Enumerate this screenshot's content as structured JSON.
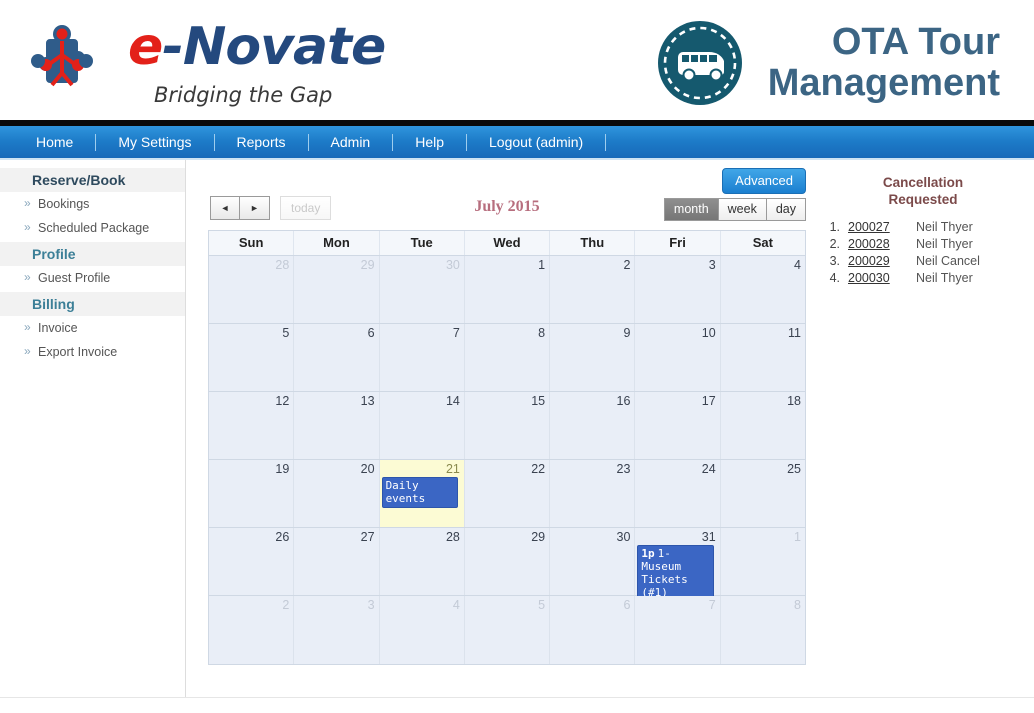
{
  "header": {
    "brand": {
      "prefix": "e",
      "dash": "-",
      "mid": "Novate",
      "tagline": "Bridging the Gap"
    },
    "app_title_line1": "OTA Tour",
    "app_title_line2": "Management",
    "bus_icon": "bus-icon",
    "logo_icon": "puzzle-person-logo"
  },
  "nav": {
    "items": [
      {
        "label": "Home"
      },
      {
        "label": "My Settings"
      },
      {
        "label": "Reports"
      },
      {
        "label": "Admin"
      },
      {
        "label": "Help"
      },
      {
        "label": "Logout (admin)"
      }
    ]
  },
  "sidebar": {
    "groups": [
      {
        "title": "Reserve/Book",
        "items": [
          {
            "label": "Bookings"
          },
          {
            "label": "Scheduled Package"
          }
        ]
      },
      {
        "title": "Profile",
        "items": [
          {
            "label": "Guest Profile"
          }
        ]
      },
      {
        "title": "Billing",
        "items": [
          {
            "label": "Invoice"
          },
          {
            "label": "Export Invoice"
          }
        ]
      }
    ],
    "bullet": "»"
  },
  "toolbar": {
    "prev_label": "◄",
    "next_label": "►",
    "today_label": "today",
    "title": "July 2015",
    "advanced_label": "Advanced",
    "views": [
      {
        "label": "month",
        "active": true
      },
      {
        "label": "week",
        "active": false
      },
      {
        "label": "day",
        "active": false
      }
    ]
  },
  "calendar": {
    "day_headers": [
      "Sun",
      "Mon",
      "Tue",
      "Wed",
      "Thu",
      "Fri",
      "Sat"
    ],
    "weeks": [
      [
        {
          "day": "28",
          "other": true
        },
        {
          "day": "29",
          "other": true
        },
        {
          "day": "30",
          "other": true
        },
        {
          "day": "1"
        },
        {
          "day": "2"
        },
        {
          "day": "3"
        },
        {
          "day": "4"
        }
      ],
      [
        {
          "day": "5"
        },
        {
          "day": "6"
        },
        {
          "day": "7"
        },
        {
          "day": "8"
        },
        {
          "day": "9"
        },
        {
          "day": "10"
        },
        {
          "day": "11"
        }
      ],
      [
        {
          "day": "12"
        },
        {
          "day": "13"
        },
        {
          "day": "14"
        },
        {
          "day": "15"
        },
        {
          "day": "16"
        },
        {
          "day": "17"
        },
        {
          "day": "18"
        }
      ],
      [
        {
          "day": "19"
        },
        {
          "day": "20"
        },
        {
          "day": "21",
          "today": true,
          "events": [
            {
              "time": "",
              "text": "Daily events"
            }
          ]
        },
        {
          "day": "22"
        },
        {
          "day": "23"
        },
        {
          "day": "24"
        },
        {
          "day": "25"
        }
      ],
      [
        {
          "day": "26"
        },
        {
          "day": "27"
        },
        {
          "day": "28"
        },
        {
          "day": "29"
        },
        {
          "day": "30"
        },
        {
          "day": "31",
          "events": [
            {
              "time": "1p",
              "text": "1- Museum Tickets (#1)"
            }
          ]
        },
        {
          "day": "1",
          "other": true
        }
      ],
      [
        {
          "day": "2",
          "other": true
        },
        {
          "day": "3",
          "other": true
        },
        {
          "day": "4",
          "other": true
        },
        {
          "day": "5",
          "other": true
        },
        {
          "day": "6",
          "other": true
        },
        {
          "day": "7",
          "other": true
        },
        {
          "day": "8",
          "other": true
        }
      ]
    ]
  },
  "cancellation_panel": {
    "title_line1": "Cancellation",
    "title_line2": "Requested",
    "rows": [
      {
        "index": "1.",
        "id": "200027",
        "name": "Neil Thyer"
      },
      {
        "index": "2.",
        "id": "200028",
        "name": "Neil Thyer"
      },
      {
        "index": "3.",
        "id": "200029",
        "name": "Neil Cancel"
      },
      {
        "index": "4.",
        "id": "200030",
        "name": "Neil Thyer"
      }
    ]
  },
  "colors": {
    "nav_blue": "#1d7bc8",
    "accent_teal": "#1b5f73",
    "brand_red": "#e32119",
    "brand_blue": "#24497e",
    "title_rose": "#b76e7e",
    "event_blue": "#3b66c4",
    "today_yellow": "#fcfbd4"
  }
}
